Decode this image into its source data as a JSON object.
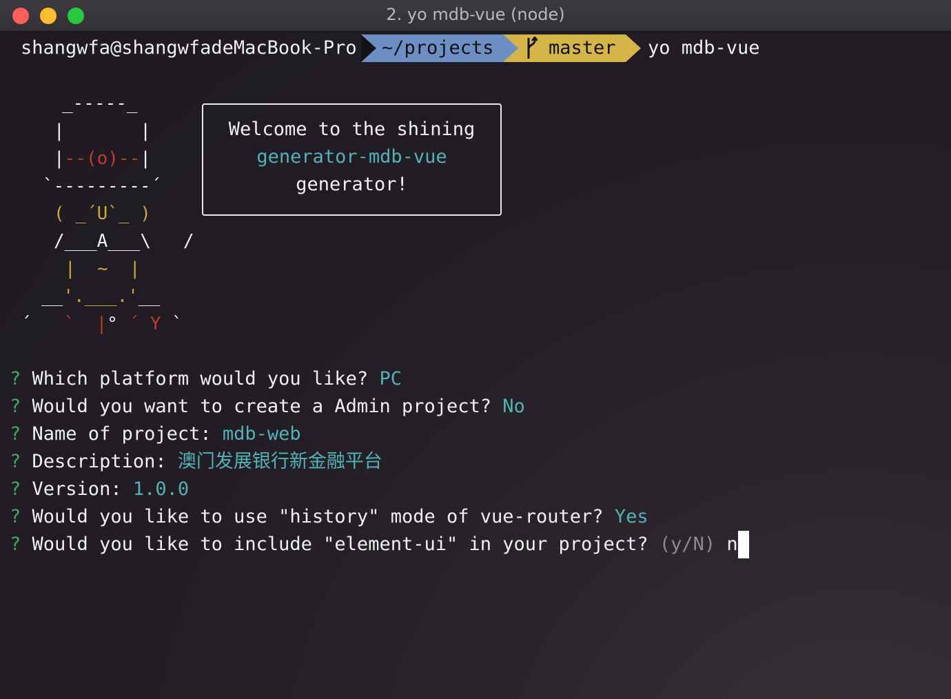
{
  "window": {
    "title": "2. yo mdb-vue (node)"
  },
  "prompt": {
    "user_host": "shangwfa@shangwfadeMacBook-Pro",
    "directory": "~/projects",
    "branch_icon": "git-branch-icon",
    "branch": "master",
    "command": "yo mdb-vue"
  },
  "welcome_box": {
    "line1": "Welcome to the shining",
    "line2": "generator-mdb-vue",
    "line3": "generator!"
  },
  "questions": [
    {
      "marker": "?",
      "text": "Which platform would you like?",
      "answer": "PC"
    },
    {
      "marker": "?",
      "text": "Would you want to create a Admin project?",
      "answer": "No"
    },
    {
      "marker": "?",
      "text": "Name of project:",
      "answer": "mdb-web"
    },
    {
      "marker": "?",
      "text": "Description:",
      "answer": "澳门发展银行新金融平台"
    },
    {
      "marker": "?",
      "text": "Version:",
      "answer": "1.0.0"
    },
    {
      "marker": "?",
      "text": "Would you like to use \"history\" mode of vue-router?",
      "answer": "Yes"
    },
    {
      "marker": "?",
      "text": "Would you like to include \"element-ui\" in your project?",
      "hint": "(y/N)",
      "input": "n"
    }
  ],
  "colors": {
    "accent_cyan": "#4fb3b8",
    "question_green": "#3fa86b",
    "dir_segment": "#6e8fc4",
    "branch_segment": "#d6b548"
  }
}
